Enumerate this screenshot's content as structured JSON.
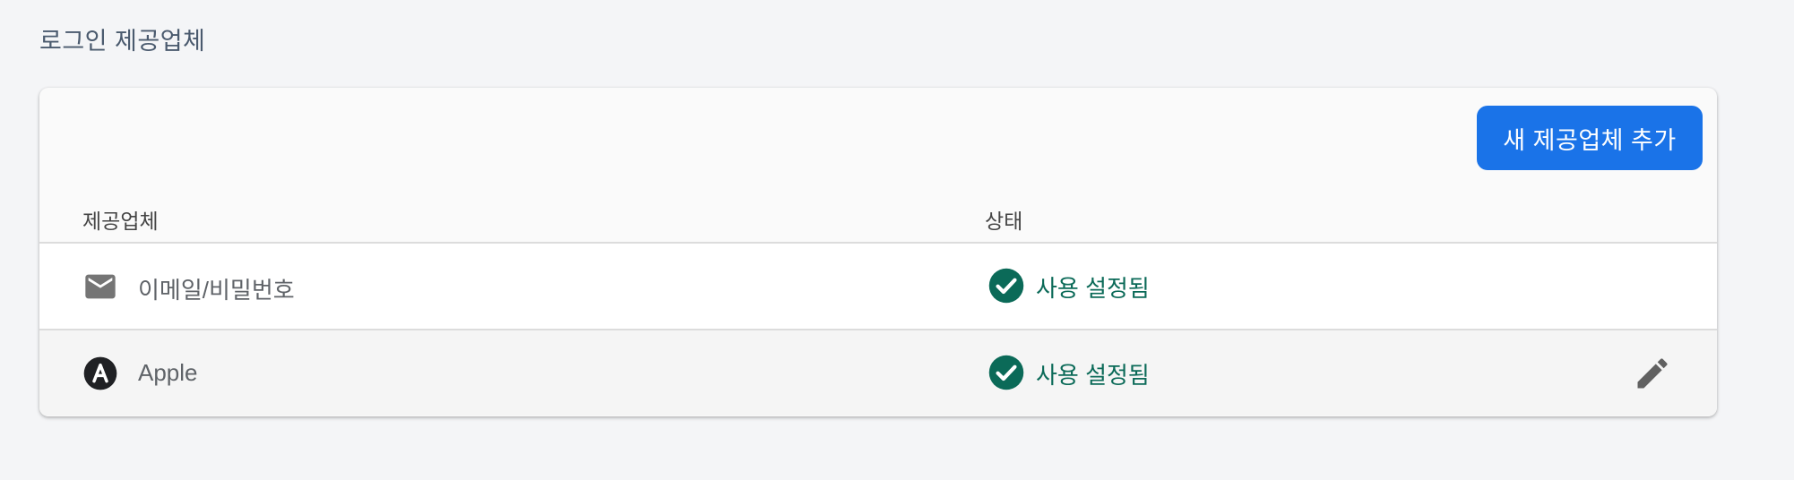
{
  "section": {
    "title": "로그인 제공업체"
  },
  "toolbar": {
    "add_provider_label": "새 제공업체 추가"
  },
  "table": {
    "headers": {
      "provider": "제공업체",
      "status": "상태"
    },
    "rows": [
      {
        "icon": "mail-icon",
        "provider": "이메일/비밀번호",
        "status_icon": "check-circle-icon",
        "status": "사용 설정됨",
        "editable": false
      },
      {
        "icon": "apple-icon",
        "provider": "Apple",
        "status_icon": "check-circle-icon",
        "status": "사용 설정됨",
        "editable": true,
        "action_icon": "edit-icon"
      }
    ]
  },
  "colors": {
    "accent": "#1a73e8",
    "status_enabled": "#0b6a58",
    "page_background": "#f4f5f7"
  }
}
